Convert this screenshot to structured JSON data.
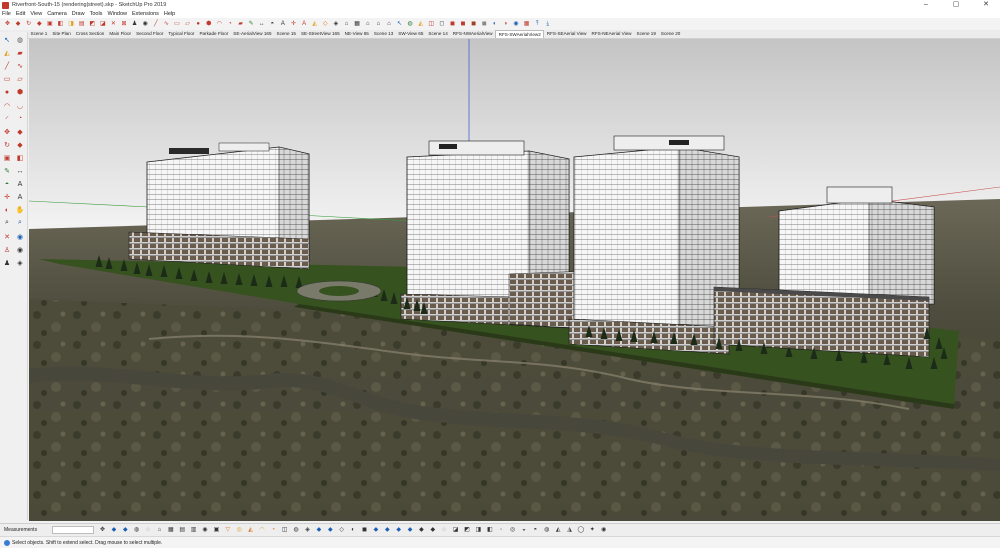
{
  "window": {
    "title": "Riverfront-South-15 (rendering|street).skp - SketchUp Pro 2019",
    "controls": [
      "–",
      "▢",
      "✕"
    ]
  },
  "menu": [
    "File",
    "Edit",
    "View",
    "Camera",
    "Draw",
    "Tools",
    "Window",
    "Extensions",
    "Help"
  ],
  "toolbar_icons": [
    {
      "name": "move-icon",
      "glyph": "✥",
      "color": "#c0392b"
    },
    {
      "name": "push-pull-icon",
      "glyph": "◆",
      "color": "#c0392b"
    },
    {
      "name": "rotate-icon",
      "glyph": "↻",
      "color": "#c0392b"
    },
    {
      "name": "follow-me-icon",
      "glyph": "◆",
      "color": "#c0392b"
    },
    {
      "name": "scale-icon",
      "glyph": "▣",
      "color": "#c0392b"
    },
    {
      "name": "offset-icon",
      "glyph": "◧",
      "color": "#c0392b"
    },
    {
      "name": "intersect-icon",
      "glyph": "◨",
      "color": "#e0a020"
    },
    {
      "name": "outer-shell-icon",
      "glyph": "▤",
      "color": "#c0392b"
    },
    {
      "name": "union-icon",
      "glyph": "◩",
      "color": "#c0392b"
    },
    {
      "name": "subtract-icon",
      "glyph": "◪",
      "color": "#c0392b"
    },
    {
      "name": "trim-icon",
      "glyph": "✕",
      "color": "#c0392b"
    },
    {
      "name": "split-icon",
      "glyph": "⊠",
      "color": "#c0392b"
    },
    {
      "name": "walk-icon",
      "glyph": "♟",
      "color": "#333333"
    },
    {
      "name": "look-around-icon",
      "glyph": "◉",
      "color": "#333333"
    },
    {
      "name": "line-icon",
      "glyph": "╱",
      "color": "#c0392b"
    },
    {
      "name": "freehand-icon",
      "glyph": "∿",
      "color": "#c0392b"
    },
    {
      "name": "rectangle-icon",
      "glyph": "▭",
      "color": "#c0392b"
    },
    {
      "name": "rotated-rectangle-icon",
      "glyph": "▱",
      "color": "#c0392b"
    },
    {
      "name": "circle-icon",
      "glyph": "●",
      "color": "#c0392b"
    },
    {
      "name": "polygon-icon",
      "glyph": "⬢",
      "color": "#c0392b"
    },
    {
      "name": "arc-icon",
      "glyph": "◠",
      "color": "#c0392b"
    },
    {
      "name": "pie-icon",
      "glyph": "◔",
      "color": "#c0392b"
    },
    {
      "name": "eraser-icon",
      "glyph": "▰",
      "color": "#c0392b"
    },
    {
      "name": "tape-measure-icon",
      "glyph": "✎",
      "color": "#2e7d32"
    },
    {
      "name": "dimension-icon",
      "glyph": "↔",
      "color": "#333333"
    },
    {
      "name": "protractor-icon",
      "glyph": "◓",
      "color": "#333333"
    },
    {
      "name": "text-icon",
      "glyph": "A",
      "color": "#333333"
    },
    {
      "name": "axes-icon",
      "glyph": "✛",
      "color": "#c0392b"
    },
    {
      "name": "3d-text-icon",
      "glyph": "A",
      "color": "#c0392b"
    },
    {
      "name": "paint-bucket-icon",
      "glyph": "◭",
      "color": "#e0a020"
    },
    {
      "name": "section-plane-icon",
      "glyph": "◇",
      "color": "#e07020"
    },
    {
      "name": "display-section-icon",
      "glyph": "◈",
      "color": "#333333"
    },
    {
      "name": "iso-view-icon",
      "glyph": "⌂",
      "color": "#333333"
    },
    {
      "name": "top-view-icon",
      "glyph": "▦",
      "color": "#333333"
    },
    {
      "name": "front-view-icon",
      "glyph": "⌂",
      "color": "#333333"
    },
    {
      "name": "right-view-icon",
      "glyph": "⌂",
      "color": "#333333"
    },
    {
      "name": "back-view-icon",
      "glyph": "⌂",
      "color": "#333333"
    },
    {
      "name": "select-icon",
      "glyph": "↖",
      "color": "#1a5fb4"
    },
    {
      "name": "make-component-icon",
      "glyph": "◍",
      "color": "#2e7d32"
    },
    {
      "name": "paint-icon",
      "glyph": "◭",
      "color": "#e0a020"
    },
    {
      "name": "xray-icon",
      "glyph": "◫",
      "color": "#c0392b"
    },
    {
      "name": "wireframe-icon",
      "glyph": "◻",
      "color": "#333333"
    },
    {
      "name": "hidden-line-icon",
      "glyph": "◼",
      "color": "#c0392b"
    },
    {
      "name": "shaded-icon",
      "glyph": "◼",
      "color": "#c0392b"
    },
    {
      "name": "textured-icon",
      "glyph": "◼",
      "color": "#a04020"
    },
    {
      "name": "monochrome-icon",
      "glyph": "◼",
      "color": "#888888"
    },
    {
      "name": "get-models-icon",
      "glyph": "◐",
      "color": "#1a5fb4"
    },
    {
      "name": "share-model-icon",
      "glyph": "◑",
      "color": "#c0392b"
    },
    {
      "name": "add-location-icon",
      "glyph": "◉",
      "color": "#1a5fb4"
    },
    {
      "name": "extension-warehouse-icon",
      "glyph": "▦",
      "color": "#c0392b"
    },
    {
      "name": "upload-icon",
      "glyph": "⤒",
      "color": "#1a5fb4"
    },
    {
      "name": "download-icon",
      "glyph": "⤓",
      "color": "#1a5fb4"
    }
  ],
  "scene_tabs": [
    "Scene 1",
    "Site Plan",
    "Cross Section",
    "Main Floor",
    "Second Floor",
    "Typical Floor",
    "Parkade Floor",
    "SE-AerialView 165",
    "Scene 15",
    "SE-StreetView 165",
    "NE-View 65",
    "Scene 13",
    "SW-View 65",
    "Scene 14",
    "RFS-NWAerialView",
    "RFS-SWAerialView2",
    "RFS-SEAerial View",
    "RFS-NEAerial View",
    "Scene 19",
    "Scene 20"
  ],
  "active_scene_index": 15,
  "left_tools": [
    {
      "name": "select-tool-icon",
      "glyph": "↖",
      "color": "#1a5fb4"
    },
    {
      "name": "make-component-tool-icon",
      "glyph": "◍",
      "color": "#555555"
    },
    {
      "name": "paint-bucket-tool-icon",
      "glyph": "◭",
      "color": "#e0a020"
    },
    {
      "name": "eraser-tool-icon",
      "glyph": "▰",
      "color": "#c0392b"
    },
    {
      "name": "line-tool-icon",
      "glyph": "╱",
      "color": "#c0392b"
    },
    {
      "name": "freehand-tool-icon",
      "glyph": "∿",
      "color": "#c0392b"
    },
    {
      "name": "rectangle-tool-icon",
      "glyph": "▭",
      "color": "#c0392b"
    },
    {
      "name": "rotated-rectangle-tool-icon",
      "glyph": "▱",
      "color": "#c0392b"
    },
    {
      "name": "circle-tool-icon",
      "glyph": "●",
      "color": "#c0392b"
    },
    {
      "name": "polygon-tool-icon",
      "glyph": "⬢",
      "color": "#c0392b"
    },
    {
      "name": "arc-tool-icon",
      "glyph": "◠",
      "color": "#c0392b"
    },
    {
      "name": "two-point-arc-tool-icon",
      "glyph": "◡",
      "color": "#c0392b"
    },
    {
      "name": "three-point-arc-tool-icon",
      "glyph": "◜",
      "color": "#c0392b"
    },
    {
      "name": "pie-tool-icon",
      "glyph": "◔",
      "color": "#c0392b"
    },
    {
      "name": "move-tool-icon",
      "glyph": "✥",
      "color": "#c0392b"
    },
    {
      "name": "push-pull-tool-icon",
      "glyph": "◆",
      "color": "#c0392b"
    },
    {
      "name": "rotate-tool-icon",
      "glyph": "↻",
      "color": "#c0392b"
    },
    {
      "name": "follow-me-tool-icon",
      "glyph": "◆",
      "color": "#c0392b"
    },
    {
      "name": "scale-tool-icon",
      "glyph": "▣",
      "color": "#c0392b"
    },
    {
      "name": "offset-tool-icon",
      "glyph": "◧",
      "color": "#c0392b"
    },
    {
      "name": "tape-measure-tool-icon",
      "glyph": "✎",
      "color": "#2e7d32"
    },
    {
      "name": "dimension-tool-icon",
      "glyph": "↔",
      "color": "#333333"
    },
    {
      "name": "protractor-tool-icon",
      "glyph": "◓",
      "color": "#2e7d32"
    },
    {
      "name": "text-tool-icon",
      "glyph": "A",
      "color": "#333333"
    },
    {
      "name": "axes-tool-icon",
      "glyph": "✛",
      "color": "#c0392b"
    },
    {
      "name": "3d-text-tool-icon",
      "glyph": "A",
      "color": "#333333"
    },
    {
      "name": "orbit-tool-icon",
      "glyph": "◐",
      "color": "#c0392b"
    },
    {
      "name": "pan-tool-icon",
      "glyph": "✋",
      "color": "#333333"
    },
    {
      "name": "zoom-tool-icon",
      "glyph": "⌕",
      "color": "#333333"
    },
    {
      "name": "zoom-window-tool-icon",
      "glyph": "⌕",
      "color": "#1a5fb4"
    },
    {
      "name": "zoom-extents-tool-icon",
      "glyph": "✕",
      "color": "#c0392b"
    },
    {
      "name": "previous-view-tool-icon",
      "glyph": "◉",
      "color": "#1a5fb4"
    },
    {
      "name": "position-camera-tool-icon",
      "glyph": "♙",
      "color": "#c0392b"
    },
    {
      "name": "look-around-tool-icon",
      "glyph": "◉",
      "color": "#333333"
    },
    {
      "name": "walk-tool-icon",
      "glyph": "♟",
      "color": "#333333"
    },
    {
      "name": "section-plane-tool-icon",
      "glyph": "◈",
      "color": "#333333"
    }
  ],
  "measurements": {
    "label": "Measurements",
    "value": ""
  },
  "bottom_icons": [
    {
      "name": "axes-shortcut-icon",
      "glyph": "✥",
      "color": "#333333"
    },
    {
      "name": "component-icon",
      "glyph": "◆",
      "color": "#1a5fb4"
    },
    {
      "name": "cube-icon",
      "glyph": "◆",
      "color": "#1a5fb4"
    },
    {
      "name": "sandbox-icon",
      "glyph": "◍",
      "color": "#333333"
    },
    {
      "name": "soften-icon",
      "glyph": "◌",
      "color": "#333333"
    },
    {
      "name": "house-icon",
      "glyph": "⌂",
      "color": "#333333"
    },
    {
      "name": "warehouse-icon",
      "glyph": "▦",
      "color": "#333333"
    },
    {
      "name": "layout-icon",
      "glyph": "▤",
      "color": "#333333"
    },
    {
      "name": "style-builder-icon",
      "glyph": "▥",
      "color": "#333333"
    },
    {
      "name": "camera-icon",
      "glyph": "◉",
      "color": "#333333"
    },
    {
      "name": "export-icon",
      "glyph": "▣",
      "color": "#333333"
    },
    {
      "name": "funnel-icon",
      "glyph": "▽",
      "color": "#e07020"
    },
    {
      "name": "sun-icon",
      "glyph": "◎",
      "color": "#e0a020"
    },
    {
      "name": "shadow-icon",
      "glyph": "◭",
      "color": "#e07020"
    },
    {
      "name": "fog-icon",
      "glyph": "◠",
      "color": "#e0a020"
    },
    {
      "name": "scenes-icon",
      "glyph": "◔",
      "color": "#e07020"
    },
    {
      "name": "flip-icon",
      "glyph": "◫",
      "color": "#333333"
    },
    {
      "name": "generate-icon",
      "glyph": "◍",
      "color": "#333333"
    },
    {
      "name": "stamp-icon",
      "glyph": "◈",
      "color": "#333333"
    },
    {
      "name": "smoove-icon",
      "glyph": "◆",
      "color": "#1a5fb4"
    },
    {
      "name": "drape-icon",
      "glyph": "◆",
      "color": "#1a5fb4"
    },
    {
      "name": "add-detail-icon",
      "glyph": "◇",
      "color": "#333333"
    },
    {
      "name": "flip-edge-icon",
      "glyph": "◐",
      "color": "#333333"
    },
    {
      "name": "solid-tools-icon",
      "glyph": "◼",
      "color": "#333333"
    },
    {
      "name": "shell-icon",
      "glyph": "◆",
      "color": "#1a5fb4"
    },
    {
      "name": "intersect-solid-icon",
      "glyph": "◆",
      "color": "#1a5fb4"
    },
    {
      "name": "union-solid-icon",
      "glyph": "◆",
      "color": "#1a5fb4"
    },
    {
      "name": "subtract-solid-icon",
      "glyph": "◆",
      "color": "#1a5fb4"
    },
    {
      "name": "trim-solid-icon",
      "glyph": "◆",
      "color": "#333333"
    },
    {
      "name": "split-solid-icon",
      "glyph": "◆",
      "color": "#333333"
    },
    {
      "name": "outliner-icon",
      "glyph": "◌",
      "color": "#333333"
    },
    {
      "name": "entity-info-icon",
      "glyph": "◪",
      "color": "#333333"
    },
    {
      "name": "materials-icon",
      "glyph": "◩",
      "color": "#333333"
    },
    {
      "name": "layers-icon",
      "glyph": "◨",
      "color": "#333333"
    },
    {
      "name": "tags-icon",
      "glyph": "◧",
      "color": "#333333"
    },
    {
      "name": "styles-icon",
      "glyph": "◦",
      "color": "#333333"
    },
    {
      "name": "fog-panel-icon",
      "glyph": "◎",
      "color": "#333333"
    },
    {
      "name": "match-photo-icon",
      "glyph": "◒",
      "color": "#333333"
    },
    {
      "name": "soften-edges-icon",
      "glyph": "◓",
      "color": "#333333"
    },
    {
      "name": "instructor-icon",
      "glyph": "◍",
      "color": "#333333"
    },
    {
      "name": "shadows-panel-icon",
      "glyph": "◭",
      "color": "#333333"
    },
    {
      "name": "terrain-icon",
      "glyph": "◮",
      "color": "#333333"
    },
    {
      "name": "info-icon",
      "glyph": "◯",
      "color": "#333333"
    },
    {
      "name": "settings-icon",
      "glyph": "✦",
      "color": "#333333"
    },
    {
      "name": "help-icon",
      "glyph": "◉",
      "color": "#333333"
    }
  ],
  "status": {
    "text": "Select objects. Shift to extend select. Drag mouse to select multiple."
  },
  "scene": {
    "sky_top": "#c8c8c8",
    "sky_bottom": "#f2f2f2",
    "ground_far": "#5d5a4c",
    "ground_near": "#4a4a34",
    "lawn": "#35521f",
    "building_light": "#f4f4f4",
    "building_edge": "#1c1c1c",
    "river": "#47473c",
    "tree": "#1c2a18",
    "axis_blue": "#4a5fd6",
    "axis_red": "#c85050",
    "axis_green": "#3a9a3a"
  }
}
